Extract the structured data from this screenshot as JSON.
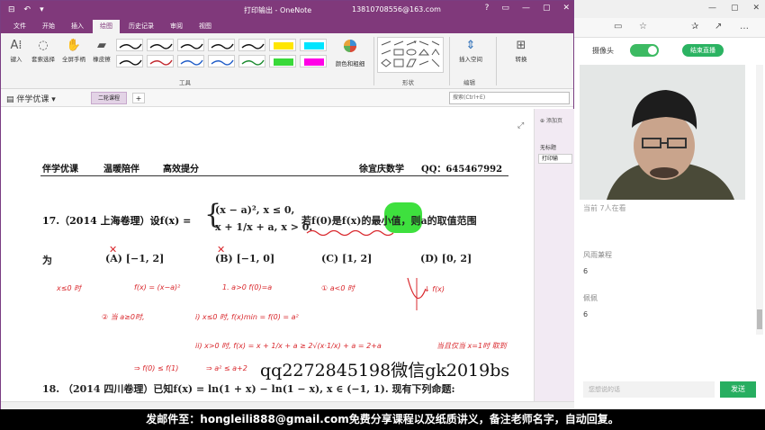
{
  "onenote": {
    "quick_access": [
      "⊟",
      "↶",
      "▾"
    ],
    "title": "打印输出 - OneNote",
    "account": "13810708556@163.com",
    "window_buttons": [
      "?",
      "▭",
      "—",
      "▢",
      "✕"
    ],
    "tabs": [
      "文件",
      "开始",
      "插入",
      "绘图",
      "历史记录",
      "审阅",
      "视图"
    ],
    "active_tab": "绘图",
    "ribbon": {
      "type_btn": "键入",
      "lasso_btn": "套索选择",
      "pan_btn": "全屏手柄",
      "eraser_btn": "橡皮擦",
      "tools_group": "工具",
      "color_btn": "颜色和粗细",
      "shapes_group": "形状",
      "insert_space": "插入空间",
      "edit_group": "编辑",
      "convert_btn": "转换"
    },
    "notebook": "伴学优课",
    "section": "二轮课程",
    "add_tab": "+",
    "search_placeholder": "搜索(Ctrl+E)",
    "page_pane": {
      "add_page": "添加页",
      "untitled": "无标题",
      "print": "打印输"
    }
  },
  "page": {
    "header": {
      "brand": "伴学优课",
      "slogan1": "温暖陪伴",
      "slogan2": "高效提分",
      "teacher": "徐宜庆数学",
      "qq": "QQ：645467992"
    },
    "q17": {
      "prefix": "17.（2014 上海卷理）设f(x) =",
      "piece1": "(x − a)², x ≤ 0,",
      "piece2": "x + 1/x + a, x > 0.",
      "condition": "若f(0)是f(x)的最小值，则a的取值范围",
      "wei": "为"
    },
    "options": [
      {
        "label": "(A)",
        "value": "[−1, 2]"
      },
      {
        "label": "(B)",
        "value": "[−1, 0]"
      },
      {
        "label": "(C)",
        "value": "[1, 2]"
      },
      {
        "label": "(D)",
        "value": "[0, 2]"
      }
    ],
    "handwriting": {
      "l1a": "x≤0 时",
      "l1b": "f(x) = (x−a)²",
      "l1c": "1. a>0 f(0)=a",
      "l1d": "① a<0 时",
      "l1e": "↓ f(x)",
      "l2a": "② 当 a≥0时,",
      "l2b": "i) x≤0 时, f(x)min = f(0) = a²",
      "l3a": "ii) x>0 时, f(x) = x + 1/x + a ≥ 2√(x·1/x) + a = 2+a",
      "l3b": "当且仅当 x=1时 取到",
      "l4a": "⇒ f(0) ≤ f(1)",
      "l4b": "⇒ a² ≤ a+2"
    },
    "watermark": "qq2272845198微信gk2019bs",
    "q18": "18. （2014 四川卷理）已知f(x) = ln(1 + x) − ln(1 − x), x ∈ (−1, 1). 现有下列命题:"
  },
  "live": {
    "camera_label": "摄像头",
    "end_live": "结束直播",
    "viewers": "当前 7人在看",
    "chats": [
      {
        "name": "风雨兼程",
        "msg": "6"
      },
      {
        "name": "佩佩",
        "msg": "6"
      }
    ],
    "input_placeholder": "您想说的话",
    "send": "发送"
  },
  "banner": "发邮件至：hongleili888@gmail.com免费分享课程以及纸质讲义，备注老师名字，自动回复。"
}
